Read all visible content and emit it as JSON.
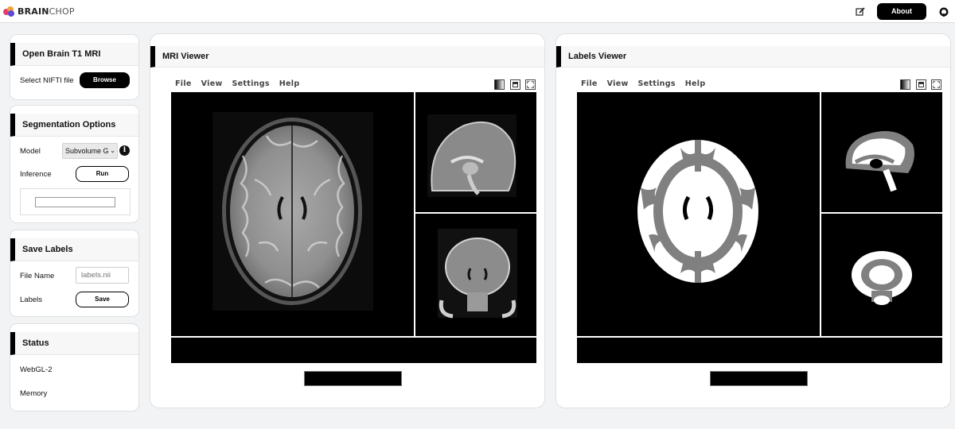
{
  "app": {
    "logo_bold": "BRAIN",
    "logo_light": "CHOP",
    "about_label": "About",
    "icons": [
      "edit-icon",
      "github-icon"
    ]
  },
  "open_card": {
    "title": "Open Brain T1 MRI",
    "select_label": "Select NIFTI file",
    "browse_label": "Browse"
  },
  "seg_card": {
    "title": "Segmentation Options",
    "model_label": "Model",
    "model_value": "Subvolume G",
    "inference_label": "Inference",
    "run_label": "Run"
  },
  "save_card": {
    "title": "Save Labels",
    "file_name_label": "File Name",
    "file_name_placeholder": "labels.nii",
    "labels_label": "Labels",
    "save_label": "Save"
  },
  "status_card": {
    "title": "Status",
    "items": [
      "WebGL-2",
      "Memory"
    ]
  },
  "mri_viewer": {
    "title": "MRI Viewer",
    "menu": [
      "File",
      "View",
      "Settings",
      "Help"
    ]
  },
  "labels_viewer": {
    "title": "Labels Viewer",
    "menu": [
      "File",
      "View",
      "Settings",
      "Help"
    ]
  },
  "colors": {
    "accent": "#000000",
    "background": "#f2f3f5",
    "label_white": "#ffffff",
    "label_gray": "#808080"
  }
}
